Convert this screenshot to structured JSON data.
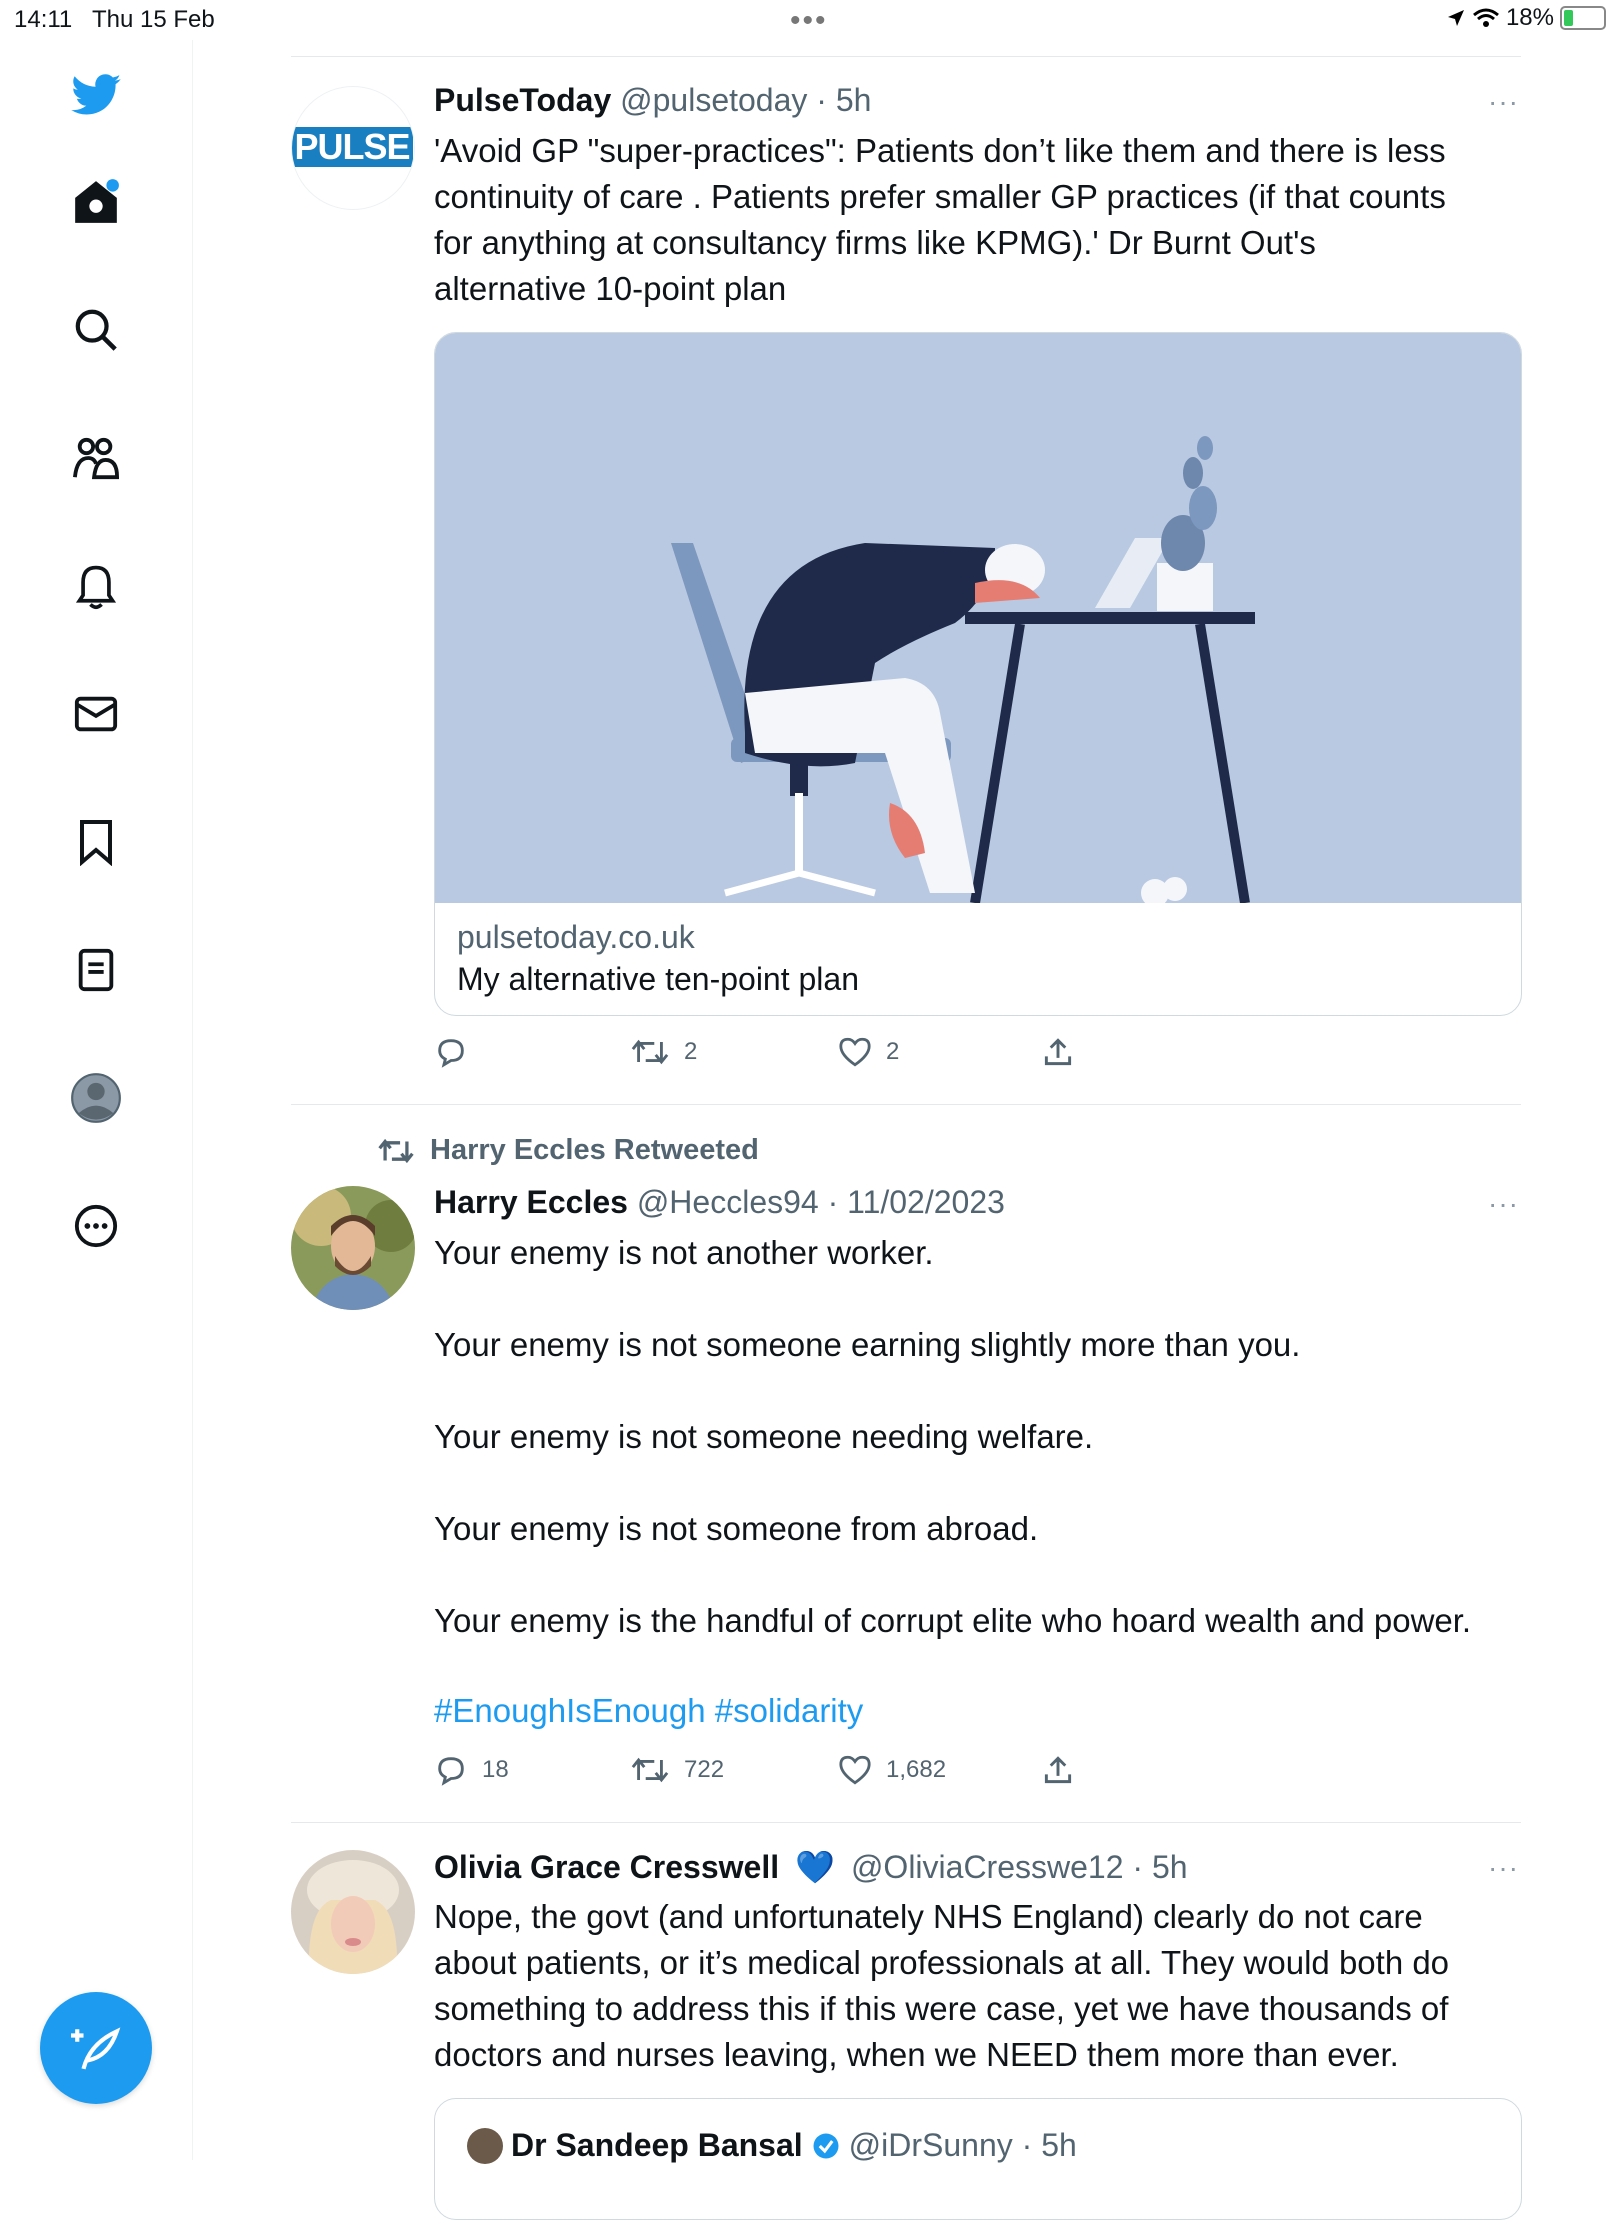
{
  "status_bar": {
    "time": "14:11",
    "date": "Thu 15 Feb",
    "battery": "18%"
  },
  "colors": {
    "accent": "#1d9bf0",
    "text": "#0f1419",
    "secondary": "#536471",
    "divider": "#e6e9eb"
  },
  "sidebar": {
    "items": [
      {
        "icon": "twitter-logo-icon"
      },
      {
        "icon": "home-icon"
      },
      {
        "icon": "search-icon"
      },
      {
        "icon": "communities-icon"
      },
      {
        "icon": "notifications-bell-icon"
      },
      {
        "icon": "messages-envelope-icon"
      },
      {
        "icon": "bookmarks-icon"
      },
      {
        "icon": "lists-icon"
      },
      {
        "icon": "profile-icon"
      },
      {
        "icon": "more-circle-icon"
      }
    ],
    "compose_icon": "compose-tweet-icon"
  },
  "tweets": [
    {
      "name": "PulseToday",
      "handle": "@pulsetoday · 5h",
      "avatar_text": "PULSE",
      "text_lines": [
        "'Avoid GP \"super-practices\": Patients don’t like them and there is less",
        "continuity of care . Patients prefer smaller GP practices (if that counts",
        "for anything at consultancy firms like KPMG).' Dr Burnt Out's",
        "alternative 10-point plan"
      ],
      "card": {
        "domain": "pulsetoday.co.uk",
        "title": "My alternative ten-point plan"
      },
      "replies": "",
      "retweets": "2",
      "likes": "2"
    },
    {
      "retweeted_by": "Harry Eccles Retweeted",
      "name": "Harry Eccles",
      "handle": "@Heccles94 · 11/02/2023",
      "text_lines": [
        "Your enemy is not another worker.",
        "Your enemy is not someone earning slightly more than you.",
        "Your enemy is not someone needing welfare.",
        "Your enemy is not someone from abroad.",
        "Your enemy is the handful of corrupt elite who hoard wealth and power."
      ],
      "hashtags": "#EnoughIsEnough #solidarity",
      "replies": "18",
      "retweets": "722",
      "likes": "1,682"
    },
    {
      "name": "Olivia Grace Cresswell",
      "badge": "💙",
      "handle": "@OliviaCresswe12 · 5h",
      "text_lines": [
        "Nope, the govt (and unfortunately NHS England) clearly do not care",
        "about patients, or it’s medical professionals at all. They would both do",
        "something to address this if this were case, yet we have thousands of",
        "doctors and nurses leaving, when we NEED them more than ever."
      ],
      "quote": {
        "name": "Dr Sandeep Bansal",
        "handle": "@iDrSunny · 5h"
      }
    }
  ],
  "more_label": "···"
}
